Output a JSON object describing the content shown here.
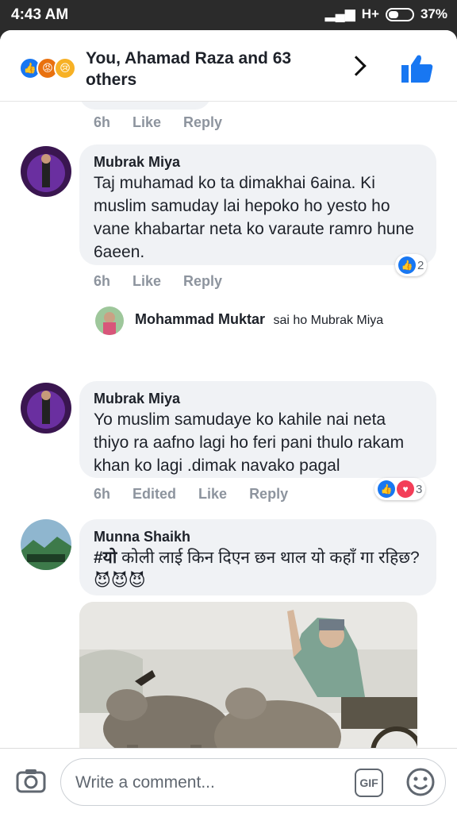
{
  "status_bar": {
    "time": "4:43 AM",
    "network": "H+",
    "battery": "37%"
  },
  "reactions_header": {
    "title": "You, Ahamad Raza and 63 others"
  },
  "prev_comment": {
    "time": "6h",
    "like": "Like",
    "reply": "Reply"
  },
  "comments": [
    {
      "author": "Mubrak Miya",
      "text": "Taj muhamad ko ta dimakhai 6aina. Ki muslim samuday lai hepoko ho yesto ho vane khabartar neta ko varaute ramro hune 6aeen.",
      "time": "6h",
      "like": "Like",
      "reply": "Reply",
      "reaction_count": "2"
    },
    {
      "author": "Mubrak Miya",
      "text": "Yo muslim samudaye ko kahile nai neta thiyo ra aafno lagi ho feri pani thulo rakam khan ko lagi .dimak navako pagal",
      "time": "6h",
      "edited": "Edited",
      "like": "Like",
      "reply": "Reply",
      "reaction_count": "3"
    },
    {
      "author": "Munna Shaikh",
      "text_hashtag": "#यो",
      "text": " कोली लाई किन दिएन छन थाल यो कहाँ गा रहिछ?",
      "emoji": "😈😈😈"
    }
  ],
  "reply_preview": {
    "author": "Mohammad Muktar",
    "text": "sai ho  Mubrak Miya"
  },
  "composer": {
    "placeholder": "Write a comment...",
    "gif_label": "GIF"
  },
  "colors": {
    "facebook_blue": "#1877f2",
    "love_red": "#f33e58",
    "text_gray": "#8d949e"
  }
}
